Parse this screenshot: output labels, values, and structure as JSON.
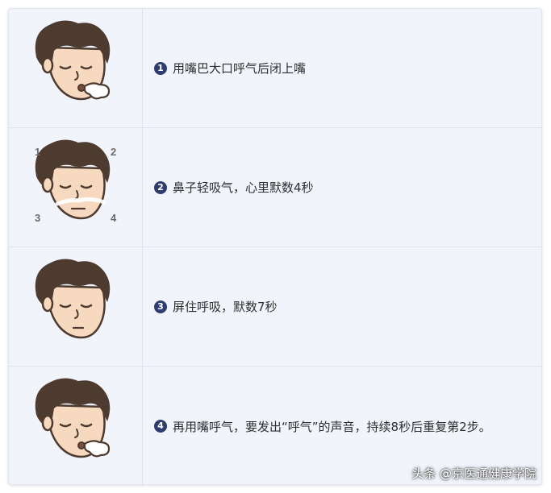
{
  "colors": {
    "card_bg": "#f1f4fb",
    "badge_bg": "#2f3d6e",
    "hair": "#4e3b30",
    "skin": "#f7d9bf",
    "text": "#2e2e2e"
  },
  "steps": [
    {
      "badge": "1",
      "text": "用嘴巴大口呼气后闭上嘴",
      "icon": "face-exhaling-mouth-icon"
    },
    {
      "badge": "2",
      "text": "鼻子轻吸气，心里默数4秒",
      "icon": "face-inhaling-nose-icon",
      "count_labels": [
        "1",
        "2",
        "3",
        "4"
      ]
    },
    {
      "badge": "3",
      "text": "屏住呼吸，默数7秒",
      "icon": "face-holding-breath-icon"
    },
    {
      "badge": "4",
      "text": "再用嘴呼气，要发出“呼气”的声音，持续8秒后重复第2步。",
      "icon": "face-exhaling-mouth-icon"
    }
  ],
  "watermark": "头条 @京医通健康学院"
}
